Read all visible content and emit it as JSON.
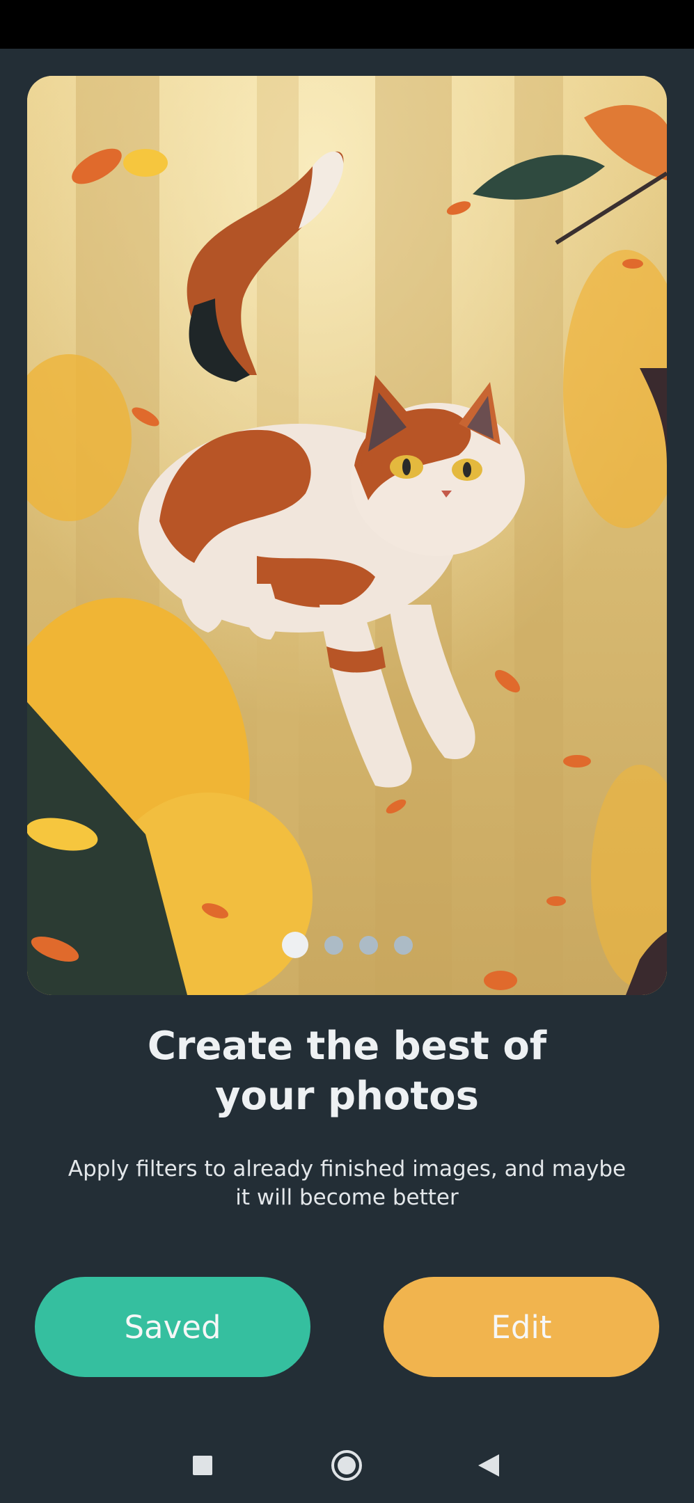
{
  "hero": {
    "illustration": "calico-cat-leaping-through-autumn-forest",
    "pager": {
      "total": 4,
      "active_index": 0
    }
  },
  "onboarding": {
    "title_line1": "Create the best of",
    "title_line2": "your photos",
    "description_line1": "Apply filters to already finished images, and maybe",
    "description_line2": "it will become better"
  },
  "actions": {
    "saved_label": "Saved",
    "edit_label": "Edit"
  },
  "colors": {
    "background": "#232e36",
    "saved_button": "#35bf9f",
    "edit_button": "#f1b44e",
    "title_text": "#eef1f3"
  },
  "navbar": {
    "recents_icon": "square-icon",
    "home_icon": "circle-home-icon",
    "back_icon": "triangle-back-icon"
  }
}
